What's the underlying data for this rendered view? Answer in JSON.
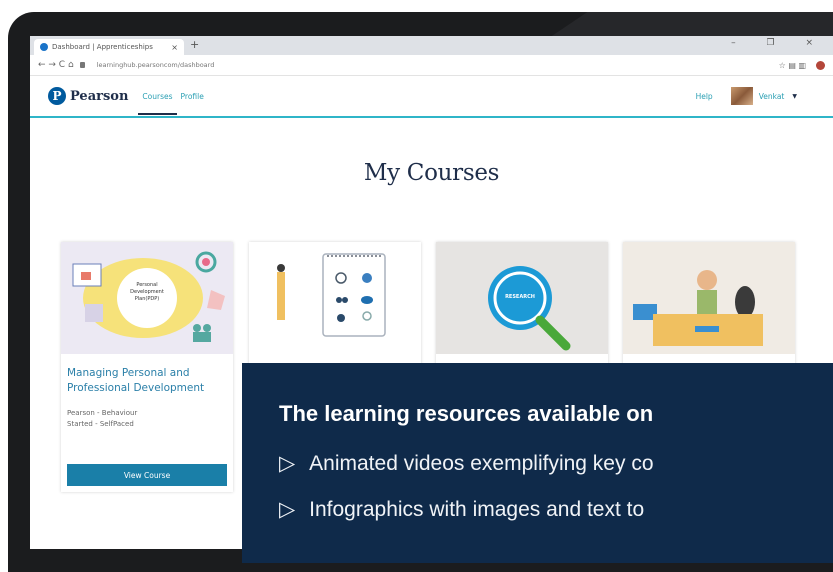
{
  "browser": {
    "tab_title": "Dashboard | Apprenticeships",
    "tab_close": "×",
    "new_tab": "+",
    "window_controls": "– ❐ ×",
    "nav": "← → C ⌂",
    "url": "learninghub.pearsoncom/dashboard",
    "addr_icons": "☆ ▤ ▥"
  },
  "header": {
    "logo_letter": "P",
    "brand": "Pearson",
    "nav": [
      "Courses",
      "Profile"
    ],
    "help": "Help",
    "user": "Venkat",
    "caret": "▼"
  },
  "main": {
    "title": "My Courses",
    "cards": [
      {
        "image_label": "Personal Development Plan(PDP)",
        "title": "Managing Personal and Professional Development",
        "subtitle_1": "Pearson - Behaviour",
        "subtitle_2": "Started - SelfPaced",
        "button": "View Course"
      },
      {
        "image_label": ""
      },
      {
        "image_label": "RESEARCH"
      },
      {
        "image_label": ""
      }
    ]
  },
  "overlay": {
    "title": "The learning resources available on",
    "items": [
      "Animated videos exemplifying key co",
      "Infographics with images and text to"
    ],
    "bullet": "▷"
  },
  "colors": {
    "accent": "#2fb5c8",
    "brand_navy": "#1f2e4a",
    "button": "#1a7fa8",
    "overlay": "#0f2a4a"
  }
}
